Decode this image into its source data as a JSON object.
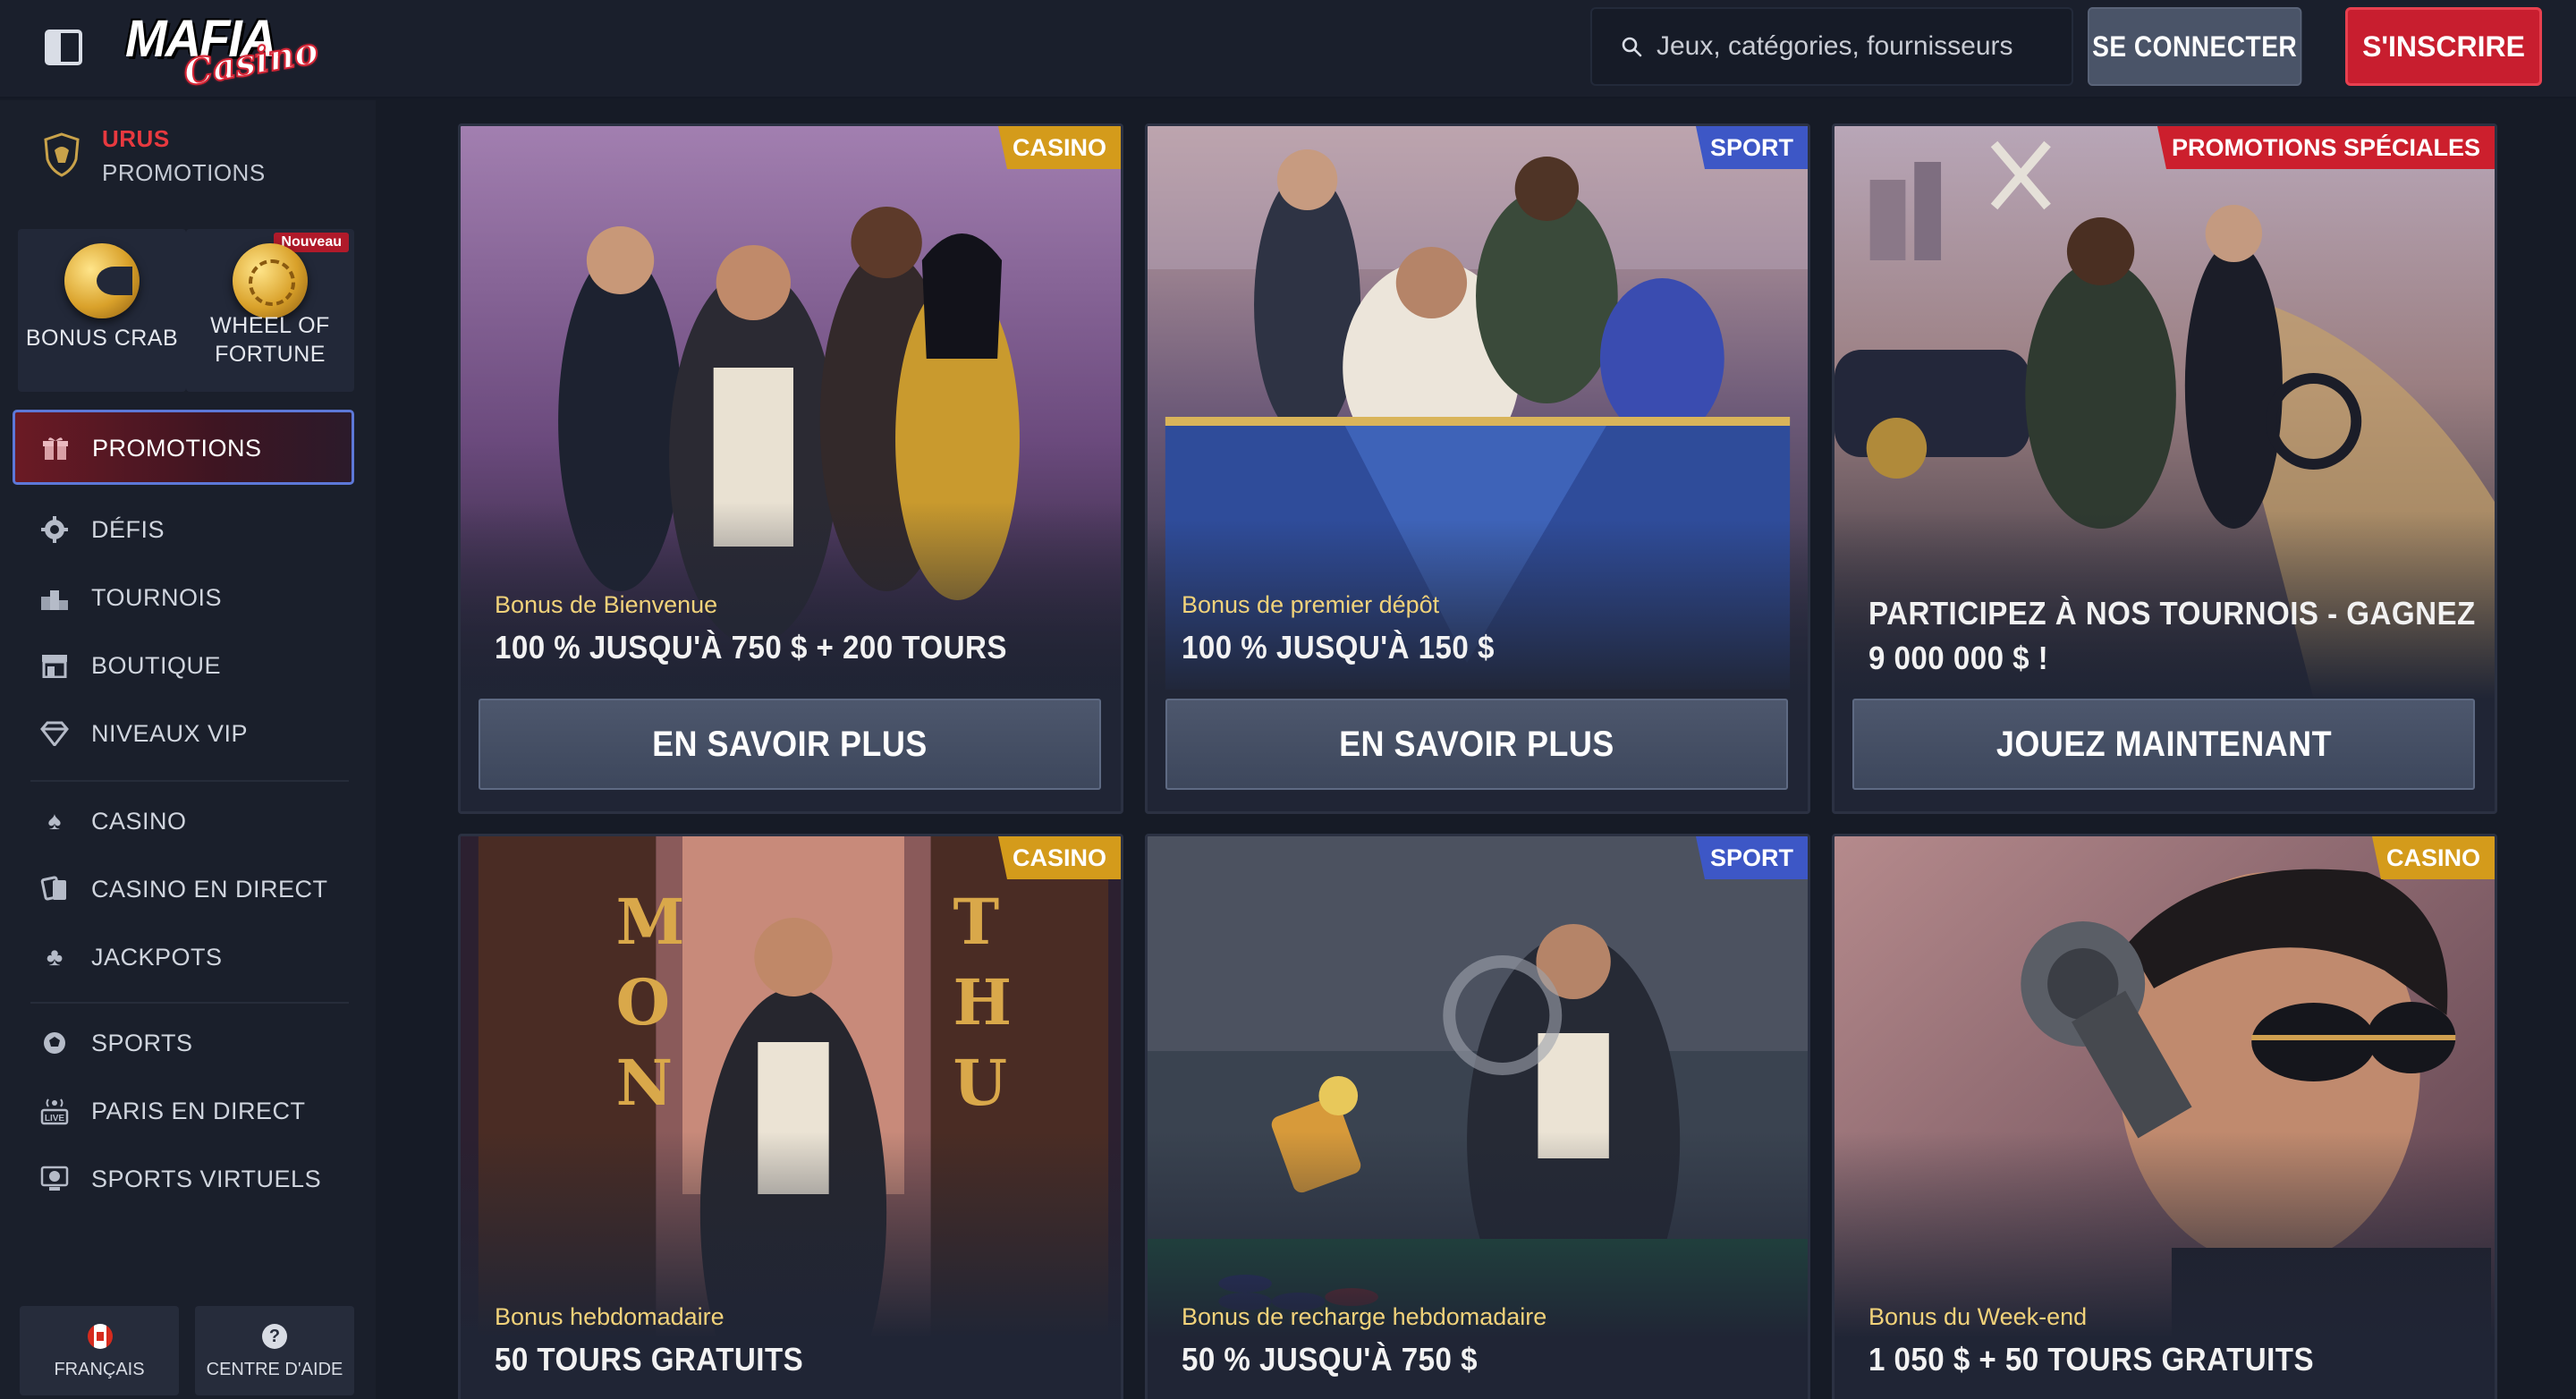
{
  "header": {
    "logo_main": "MAFIA",
    "logo_script": "Casino",
    "search_placeholder": "Jeux, catégories, fournisseurs",
    "login_label": "SE CONNECTER",
    "signup_label": "S'INSCRIRE"
  },
  "sidebar": {
    "promo_title": "URUS",
    "promo_subtitle": "PROMOTIONS",
    "tiles": [
      {
        "label": "BONUS CRAB"
      },
      {
        "label_line1": "WHEEL OF",
        "label_line2": "FORTUNE",
        "badge": "Nouveau"
      }
    ],
    "active_item": {
      "label": "PROMOTIONS",
      "icon": "gift-icon"
    },
    "items": [
      {
        "label": "DÉFIS",
        "icon": "gear-badge-icon"
      },
      {
        "label": "TOURNOIS",
        "icon": "podium-icon"
      },
      {
        "label": "BOUTIQUE",
        "icon": "shop-icon"
      },
      {
        "label": "NIVEAUX VIP",
        "icon": "diamond-icon"
      },
      {
        "label": "CASINO",
        "icon": "spade-icon"
      },
      {
        "label": "CASINO EN DIRECT",
        "icon": "live-cards-icon"
      },
      {
        "label": "JACKPOTS",
        "icon": "clover-icon"
      },
      {
        "label": "SPORTS",
        "icon": "ball-icon"
      },
      {
        "label": "PARIS EN DIRECT",
        "icon": "live-icon"
      },
      {
        "label": "SPORTS VIRTUELS",
        "icon": "virtual-ball-icon"
      }
    ],
    "language_label": "FRANÇAIS",
    "help_label": "CENTRE D'AIDE",
    "help_glyph": "?"
  },
  "cards": [
    {
      "tag": "CASINO",
      "subtitle": "Bonus de Bienvenue",
      "title": "100 % JUSQU'À 750 $ + 200 TOURS",
      "cta": "EN SAVOIR PLUS"
    },
    {
      "tag": "SPORT",
      "subtitle": "Bonus de premier dépôt",
      "title": "100 % JUSQU'À 150 $",
      "cta": "EN SAVOIR PLUS"
    },
    {
      "tag": "PROMOTIONS SPÉCIALES",
      "title_line1": "PARTICIPEZ À NOS TOURNOIS - GAGNEZ",
      "title_line2": "9 000 000 $ !",
      "cta": "JOUEZ MAINTENANT"
    },
    {
      "tag": "CASINO",
      "subtitle": "Bonus hebdomadaire",
      "title": "50 TOURS GRATUITS"
    },
    {
      "tag": "SPORT",
      "subtitle": "Bonus de recharge hebdomadaire",
      "title": "50 % JUSQU'À 750 $"
    },
    {
      "tag": "CASINO",
      "subtitle": "Bonus du Week-end",
      "title": "1 050 $ + 50 TOURS GRATUITS"
    }
  ],
  "colors": {
    "background": "#161b26",
    "sidebar": "#1a1f2b",
    "accent_red": "#c81e2f",
    "tag_casino": "#d49b1b",
    "tag_sport": "#3d57c6",
    "active_border": "#5d78d8"
  }
}
